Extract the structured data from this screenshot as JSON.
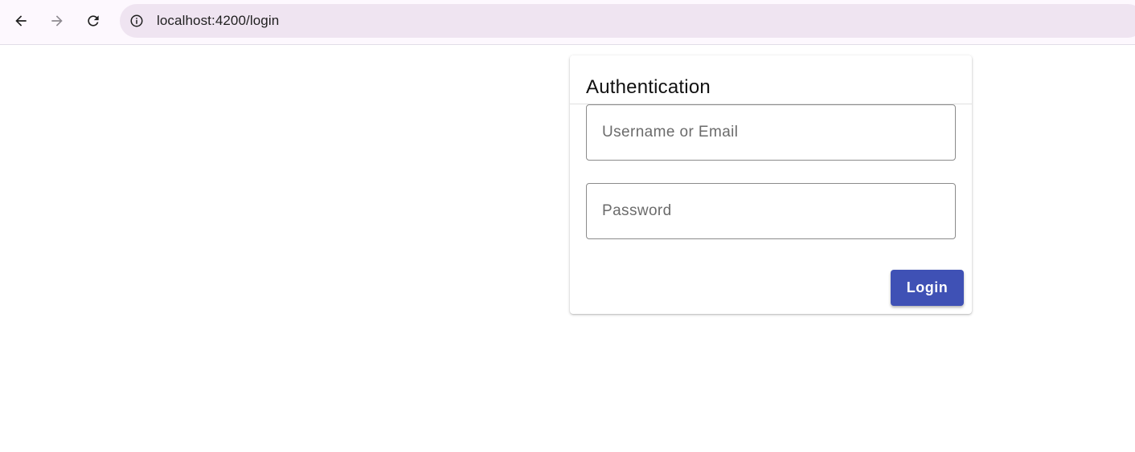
{
  "browser": {
    "url": "localhost:4200/login",
    "icons": {
      "back": "arrow-back-icon",
      "forward": "arrow-forward-icon",
      "reload": "reload-icon",
      "site_info": "info-icon"
    }
  },
  "login_card": {
    "title": "Authentication",
    "username_placeholder": "Username or Email",
    "password_placeholder": "Password",
    "submit_label": "Login"
  },
  "colors": {
    "primary": "#3f51b5",
    "address_bar": "#efe4f1",
    "toolbar": "#fdf8fe"
  }
}
